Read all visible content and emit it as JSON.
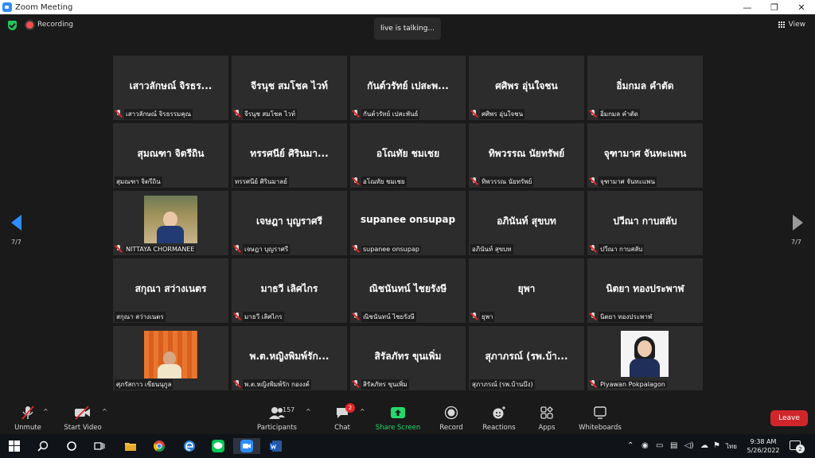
{
  "window": {
    "title": "Zoom Meeting",
    "minimize": "—",
    "maximize": "❐",
    "close": "✕"
  },
  "topbar": {
    "recording_label": "Recording",
    "talking": "live is talking...",
    "view_label": "View"
  },
  "pager": {
    "left": "7/7",
    "right": "7/7"
  },
  "tiles": [
    {
      "display": "เสาวลักษณ์ จิรธร...",
      "caption": "เสาวลักษณ์ จิรธรรมคุณ",
      "muted": true
    },
    {
      "display": "จีรนุช สมโชค ไวท์",
      "caption": "จีรนุช สมโชค ไวท์",
      "muted": true
    },
    {
      "display": "กันต์วรัทย์ เปสะพ...",
      "caption": "กันต์วรัทย์ เปสะพันธ์",
      "muted": true
    },
    {
      "display": "ศศิพร อุ่นใจชน",
      "caption": "ศศิพร อุ่นใจชน",
      "muted": true
    },
    {
      "display": "อิ่มกมล คำตัด",
      "caption": "อิ่มกมล คำตัด",
      "muted": true
    },
    {
      "display": "สุมณฑา จิตรีถิน",
      "caption": "สุมณฑา จิตรีถิน",
      "muted": false
    },
    {
      "display": "ทรรศนีย์ ศิรินมา...",
      "caption": "ทรรศนีย์ ศิรินมาลย์",
      "muted": false
    },
    {
      "display": "อโณทัย ชมเชย",
      "caption": "อโณทัย ชมเชย",
      "muted": true
    },
    {
      "display": "ทิพวรรณ นัยทรัพย์",
      "caption": "ทิพวรรณ นัยทรัพย์",
      "muted": true
    },
    {
      "display": "จุฑามาศ จันทะแพน",
      "caption": "จุฑามาศ จันทะแพน",
      "muted": true
    },
    {
      "display": "",
      "caption": "NITTAYA CHORMANEE",
      "muted": true,
      "photo": "office"
    },
    {
      "display": "เจษฎา บุญราศรี",
      "caption": "เจษฎา บุญราศรี",
      "muted": true
    },
    {
      "display": "supanee onsupap",
      "caption": "supanee onsupap",
      "muted": true
    },
    {
      "display": "อภินันท์ สุขบท",
      "caption": "อภินันท์ สุขบท",
      "muted": false
    },
    {
      "display": "ปวีณา กาบสลับ",
      "caption": "ปวีณา กาบสลับ",
      "muted": true
    },
    {
      "display": "สกุณา สว่างเนตร",
      "caption": "สกุณา สว่างเนตร",
      "muted": false
    },
    {
      "display": "มาธวี เลิศไกร",
      "caption": "มาธวี เลิศไกร",
      "muted": true
    },
    {
      "display": "ณิชนันทน์ ไชยรังษี",
      "caption": "ณิชนันทน์ ไชยรังษี",
      "muted": true
    },
    {
      "display": "ยุพา",
      "caption": "ยุพา",
      "muted": true
    },
    {
      "display": "นิตยา ทองประพาฬ",
      "caption": "นิตยา ทองประพาฬ",
      "muted": true
    },
    {
      "display": "",
      "caption": "ศุภรัสกาว เขียนนุกูล",
      "muted": false,
      "photo": "orange"
    },
    {
      "display": "พ.ต.หญิงพิมพ์รัก...",
      "caption": "พ.ต.หญิงพิมพ์รัก กองงค์",
      "muted": true
    },
    {
      "display": "สิรัลภัทร ขุนเพิ่ม",
      "caption": "สิรัลภัทร ขุนเพิ่ม",
      "muted": true
    },
    {
      "display": "สุภาภรณ์ (รพ.บ้า...",
      "caption": "สุภาภรณ์ (รพ.บ้านบึง)",
      "muted": false
    },
    {
      "display": "",
      "caption": "Piyawan Pokpalagon",
      "muted": true,
      "photo": "portrait"
    }
  ],
  "toolbar": {
    "unmute": "Unmute",
    "start_video": "Start Video",
    "participants": "Participants",
    "participants_count": "157",
    "chat": "Chat",
    "chat_badge": "2",
    "share_screen": "Share Screen",
    "record": "Record",
    "reactions": "Reactions",
    "apps": "Apps",
    "whiteboards": "Whiteboards",
    "leave": "Leave",
    "caret": "^"
  },
  "taskbar": {
    "ime": "ไทย",
    "time": "9:38 AM",
    "date": "5/26/2022",
    "notifications": "2"
  },
  "colors": {
    "accent": "#2d8cff",
    "leave": "#d0262b",
    "share": "#23d96b",
    "tile": "#2c2c2c"
  }
}
